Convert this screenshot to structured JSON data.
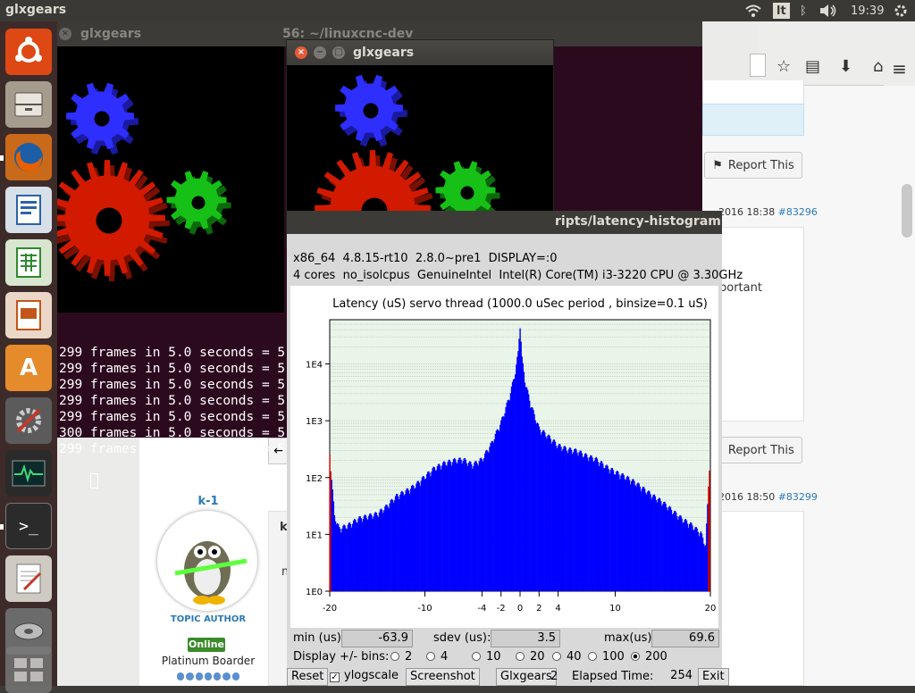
{
  "topbar": {
    "title": "glxgears",
    "keyboard": "lt",
    "time": "19:39"
  },
  "launcher": {
    "items": [
      "ubuntu-logo-icon",
      "files-icon",
      "firefox-icon",
      "writer-icon",
      "calc-icon",
      "impress-icon",
      "software-center-icon",
      "settings-icon",
      "system-monitor-icon",
      "terminal-icon",
      "text-editor-icon",
      "disk-icon",
      "workspace-switcher-icon"
    ]
  },
  "browser": {
    "report_label": "Report This",
    "post1": {
      "date": "2016 18:38",
      "id": "#83296"
    },
    "post2": {
      "date": "2016 18:50",
      "id": "#83299"
    },
    "snippet": "portant",
    "author": {
      "name": "k-1",
      "badge": "TOPIC AUTHOR",
      "status": "Online",
      "rank": "Platinum Boarder",
      "tab": "k-",
      "msg": "m"
    }
  },
  "terminal": {
    "title": "glxgears",
    "title2": "56: ~/linuxcnc-dev",
    "lines": [
      "299 frames in 5.0 seconds = 5",
      "299 frames in 5.0 seconds = 5",
      "299 frames in 5.0 seconds = 5",
      "299 frames in 5.0 seconds = 5",
      "299 frames in 5.0 seconds = 5",
      "300 frames in 5.0 seconds = 5",
      "299 frames in 5.0 seconds = 5"
    ]
  },
  "glxgears": {
    "title": "glxgears"
  },
  "histogram": {
    "title": "ripts/latency-histogram",
    "info1": "x86_64  4.8.15-rt10  2.8.0~pre1  DISPLAY=:0",
    "info2": "4 cores  no_isolcpus  GenuineIntel  Intel(R) Core(TM) i3-3220 CPU @ 3.30GHz",
    "min_label": "min (us)",
    "min": "-63.9",
    "sdev_label": "sdev (us):",
    "sdev": "3.5",
    "max_label": "max(us)",
    "max": "69.6",
    "bins_label": "Display +/- bins:",
    "bins": [
      "2",
      "4",
      "10",
      "20",
      "40",
      "100",
      "200"
    ],
    "bins_selected": "200",
    "buttons": {
      "reset": "Reset",
      "ylog": "ylogscale",
      "screenshot": "Screenshot",
      "glxgears": "Glxgears",
      "glx_count": "2",
      "elapsed_label": "Elapsed Time:",
      "elapsed": "254",
      "exit": "Exit"
    },
    "colors": {
      "bars": "#0000ff",
      "edge_bars": "#cc0000",
      "grid_bg": "#e8f5e8"
    }
  },
  "chart_data": {
    "type": "bar",
    "title": "Latency (uS) servo thread (1000.0 uSec period , binsize=0.1 uS)",
    "xlabel": "",
    "ylabel": "",
    "yscale": "log",
    "xlim": [
      -20,
      20
    ],
    "ylim": [
      1,
      60000
    ],
    "x_ticks": [
      "-20",
      "-10",
      "-4",
      "-2",
      "0",
      "2",
      "4",
      "10",
      "20"
    ],
    "y_ticks": [
      "1E0",
      "1E1",
      "1E2",
      "1E3",
      "1E4"
    ],
    "envelope": {
      "x": [
        -20,
        -19.5,
        -19,
        -18,
        -17,
        -16,
        -15,
        -14,
        -13,
        -12,
        -11,
        -10,
        -9,
        -8,
        -7,
        -6,
        -5,
        -4,
        -3,
        -2,
        -1.5,
        -1,
        -0.5,
        -0.2,
        0,
        0.2,
        0.5,
        1,
        1.5,
        2,
        3,
        4,
        5,
        6,
        7,
        8,
        9,
        10,
        11,
        12,
        13,
        14,
        15,
        16,
        17,
        18,
        19,
        19.5,
        20
      ],
      "y": [
        250,
        20,
        12,
        14,
        18,
        20,
        22,
        30,
        45,
        55,
        70,
        100,
        140,
        170,
        190,
        200,
        160,
        200,
        380,
        900,
        1600,
        3000,
        7000,
        15000,
        50000,
        12000,
        5000,
        2200,
        1200,
        700,
        500,
        350,
        300,
        280,
        230,
        200,
        150,
        120,
        100,
        80,
        60,
        45,
        35,
        25,
        18,
        14,
        10,
        6,
        350
      ]
    },
    "grid": true
  }
}
